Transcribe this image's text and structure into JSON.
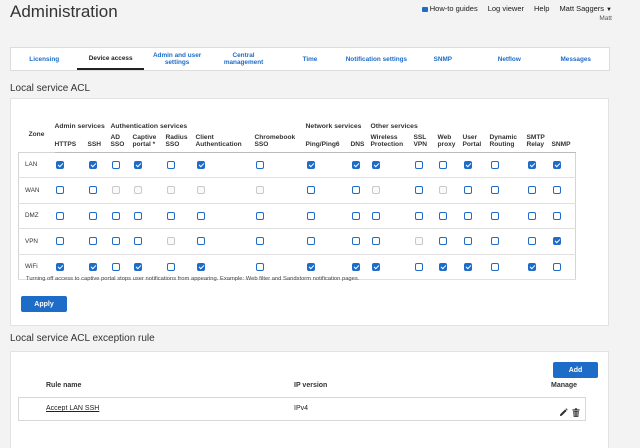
{
  "header": {
    "title": "Administration",
    "links": {
      "how_to": "How-to guides",
      "log_viewer": "Log viewer",
      "help": "Help",
      "user": "Matt Saggers",
      "user_sub": "Matt"
    }
  },
  "tabs": [
    {
      "label": "Licensing"
    },
    {
      "label": "Device access",
      "active": true
    },
    {
      "label": "Admin and user settings"
    },
    {
      "label": "Central management"
    },
    {
      "label": "Time"
    },
    {
      "label": "Notification settings"
    },
    {
      "label": "SNMP"
    },
    {
      "label": "Netflow"
    },
    {
      "label": "Messages"
    }
  ],
  "acl": {
    "section_title": "Local service ACL",
    "zone_header": "Zone",
    "groups": [
      "Admin services",
      "Authentication services",
      "Network services",
      "Other services"
    ],
    "columns": [
      "HTTPS",
      "SSH",
      "AD SSO",
      "Captive portal *",
      "Radius SSO",
      "Client Authentication",
      "Chromebook SSO",
      "Ping/Ping6",
      "DNS",
      "Wireless Protection",
      "SSL VPN",
      "Web proxy",
      "User Portal",
      "Dynamic Routing",
      "SMTP Relay",
      "SNMP"
    ],
    "rows": [
      {
        "zone": "LAN",
        "states": [
          "on",
          "on",
          "off",
          "on",
          "off",
          "on",
          "off",
          "on",
          "on",
          "on",
          "off",
          "off",
          "on",
          "off",
          "on",
          "on"
        ]
      },
      {
        "zone": "WAN",
        "states": [
          "off",
          "off",
          "dis",
          "dis",
          "dis",
          "dis",
          "dis",
          "off",
          "off",
          "dis",
          "off",
          "dis",
          "off",
          "off",
          "off",
          "off"
        ]
      },
      {
        "zone": "DMZ",
        "states": [
          "off",
          "off",
          "off",
          "off",
          "off",
          "off",
          "off",
          "off",
          "off",
          "off",
          "off",
          "off",
          "off",
          "off",
          "off",
          "off"
        ]
      },
      {
        "zone": "VPN",
        "states": [
          "off",
          "off",
          "off",
          "off",
          "dis",
          "off",
          "off",
          "off",
          "off",
          "off",
          "dis",
          "off",
          "off",
          "off",
          "off",
          "on"
        ]
      },
      {
        "zone": "WiFi",
        "states": [
          "on",
          "on",
          "off",
          "on",
          "off",
          "on",
          "off",
          "on",
          "on",
          "on",
          "off",
          "on",
          "on",
          "off",
          "on",
          "off"
        ]
      }
    ],
    "note": "Turning off access to captive portal stops user notifications from appearing. Example: Web filter and Sandstorm notification pages.",
    "apply_label": "Apply"
  },
  "exceptions": {
    "section_title": "Local service ACL exception rule",
    "add_label": "Add",
    "headers": {
      "rule_name": "Rule name",
      "ip_version": "IP version",
      "manage": "Manage"
    },
    "rows": [
      {
        "rule_name": "Accept LAN SSH",
        "ip_version": "IPv4"
      }
    ]
  },
  "colors": {
    "accent": "#1d6cc7",
    "background": "#f3f3f3"
  }
}
